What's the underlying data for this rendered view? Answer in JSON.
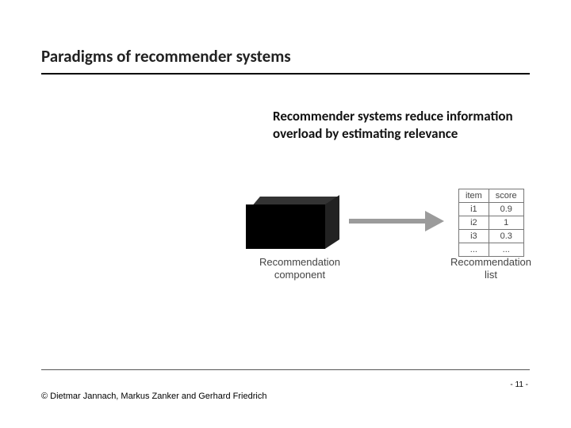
{
  "title": "Paradigms of recommender systems",
  "body_text": "Recommender systems reduce information overload by estimating relevance",
  "diagram": {
    "caption_left_line1": "Recommendation",
    "caption_left_line2": "component",
    "caption_right_line1": "Recommendation",
    "caption_right_line2": "list",
    "table": {
      "header_item": "item",
      "header_score": "score",
      "rows": [
        {
          "item": "i1",
          "score": "0.9"
        },
        {
          "item": "i2",
          "score": "1"
        },
        {
          "item": "i3",
          "score": "0.3"
        },
        {
          "item": "...",
          "score": "..."
        }
      ]
    }
  },
  "footer": {
    "copyright": "© Dietmar Jannach, Markus Zanker and Gerhard Friedrich",
    "page": "- 11 -"
  }
}
